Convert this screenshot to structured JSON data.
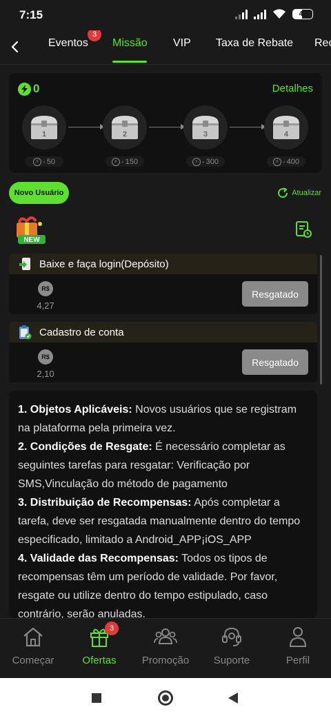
{
  "status_bar": {
    "time": "7:15",
    "battery": "42"
  },
  "tabs": {
    "items": [
      {
        "label": "Eventos",
        "badge": "3"
      },
      {
        "label": "Missão",
        "active": true
      },
      {
        "label": "VIP"
      },
      {
        "label": "Taxa de Rebate"
      },
      {
        "label": "Rec"
      }
    ]
  },
  "chests": {
    "points": "0",
    "details_label": "Detalhes",
    "items": [
      {
        "number": "1",
        "cost": "50"
      },
      {
        "number": "2",
        "cost": "150"
      },
      {
        "number": "3",
        "cost": "300"
      },
      {
        "number": "4",
        "cost": "400"
      }
    ]
  },
  "section": {
    "chip_label": "Novo Usuário",
    "refresh_label": "Atualizar",
    "new_badge": "NEW"
  },
  "tasks": [
    {
      "title": "Baixe e faça login(Depósito)",
      "currency": "R$",
      "amount": "4,27",
      "button": "Resgatado"
    },
    {
      "title": "Cadastro de conta",
      "currency": "R$",
      "amount": "2,10",
      "button": "Resgatado"
    }
  ],
  "rules": [
    {
      "heading": "1. Objetos Aplicáveis:",
      "text": " Novos usuários que se registram na plataforma pela primeira vez."
    },
    {
      "heading": "2. Condições de Resgate:",
      "text": " É necessário completar as seguintes tarefas para resgatar: Verificação por SMS,Vinculação do método de pagamento"
    },
    {
      "heading": "3. Distribuição de Recompensas:",
      "text": " Após completar a tarefa, deve ser resgatada manualmente dentro do tempo especificado, limitado a Android_APP¡iOS_APP"
    },
    {
      "heading": "4. Validade das Recompensas:",
      "text": " Todos os tipos de recompensas têm um período de validade. Por favor, resgate ou utilize dentro do tempo estipulado, caso contrário, serão anuladas."
    }
  ],
  "bottom_nav": {
    "items": [
      {
        "label": "Começar",
        "icon": "home-icon"
      },
      {
        "label": "Ofertas",
        "icon": "gift-icon",
        "badge": "3",
        "active": true
      },
      {
        "label": "Promoção",
        "icon": "people-icon"
      },
      {
        "label": "Suporte",
        "icon": "headset-icon"
      },
      {
        "label": "Perfil",
        "icon": "person-icon"
      }
    ]
  },
  "colors": {
    "accent": "#5de02e",
    "background": "#1a1a1a",
    "card": "#111111",
    "badge": "#e23a3a"
  }
}
